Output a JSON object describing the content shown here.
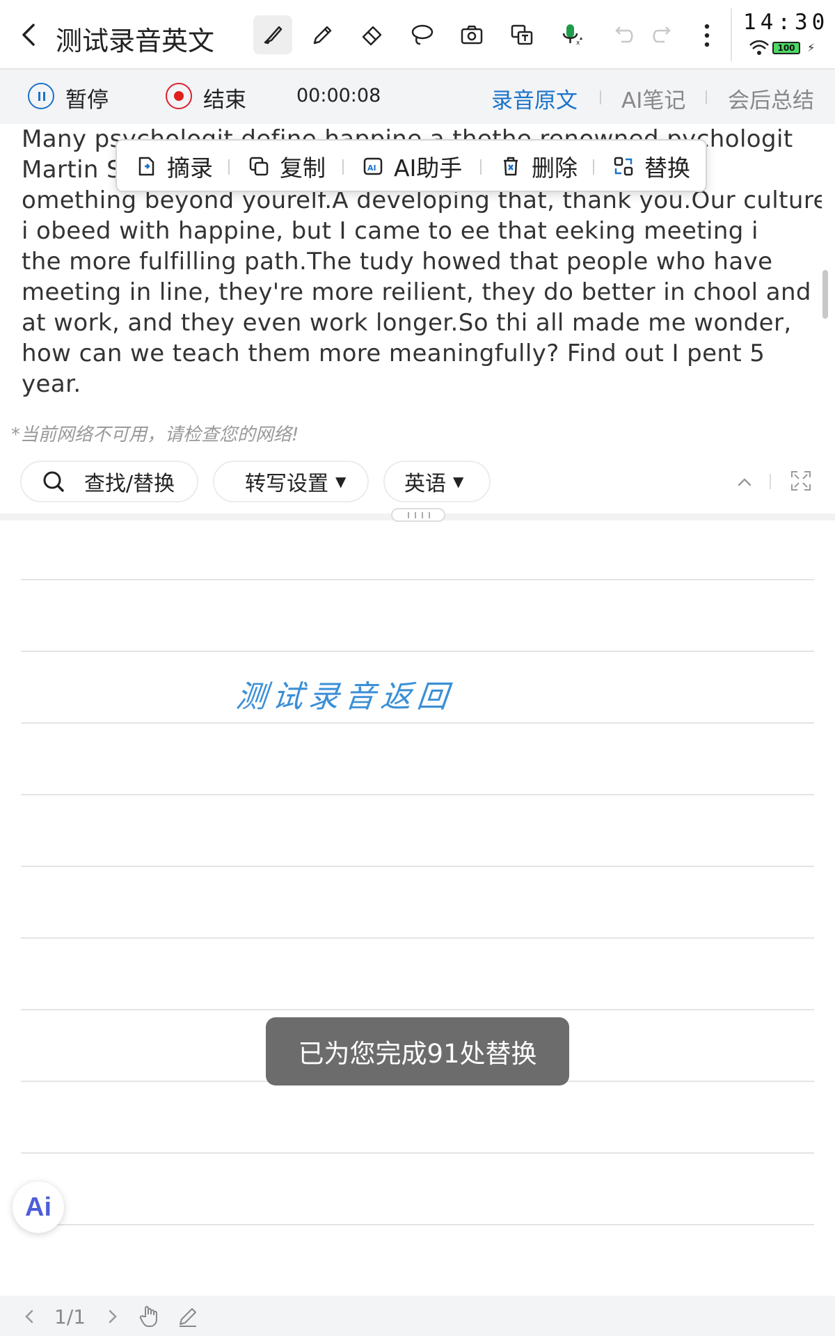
{
  "header": {
    "title": "测试录音英文",
    "tools": [
      "brush-icon",
      "pen-icon",
      "eraser-icon",
      "lasso-icon",
      "camera-icon",
      "translate-icon",
      "mic-icon",
      "undo-icon",
      "redo-icon",
      "more-icon"
    ]
  },
  "status": {
    "time": "14:30",
    "battery": "100"
  },
  "recording": {
    "pause_label": "暂停",
    "end_label": "结束",
    "timer": "00:00:08",
    "tabs": [
      {
        "label": "录音原文",
        "active": true
      },
      {
        "label": "AI笔记",
        "active": false
      },
      {
        "label": "会后总结",
        "active": false
      }
    ]
  },
  "transcript": {
    "lines": [
      "Many psychologit define happine a thethe renowned pychologit",
      "Martin S",
      "omething beyond yourelf.A developing that, thank you.Our culture",
      "i obeed with happine, but I came to ee that eeking meeting i",
      "the more fulfilling path.The tudy howed that people who have",
      "meeting in line, they're more reilient, they do better in chool and",
      "at work, and they even work longer.So thi all made me wonder,",
      "how can we teach them more meaningfully? Find out I pent 5",
      "year."
    ]
  },
  "popup": {
    "excerpt": "摘录",
    "copy": "复制",
    "ai_assistant": "AI助手",
    "delete": "删除",
    "replace": "替换"
  },
  "notice": "*当前网络不可用，请检查您的网络!",
  "controls": {
    "find_replace": "查找/替换",
    "transcribe_settings": "转写设置",
    "language": "英语"
  },
  "notebook": {
    "handwriting": "测试录音返回"
  },
  "toast": "已为您完成91处替换",
  "ai_button": "Ai",
  "footer": {
    "page": "1/1"
  },
  "colors": {
    "accent": "#1a73c9",
    "stop": "#e02020",
    "handwriting": "#3b8fd6",
    "toast_bg": "#6c6c6c"
  }
}
